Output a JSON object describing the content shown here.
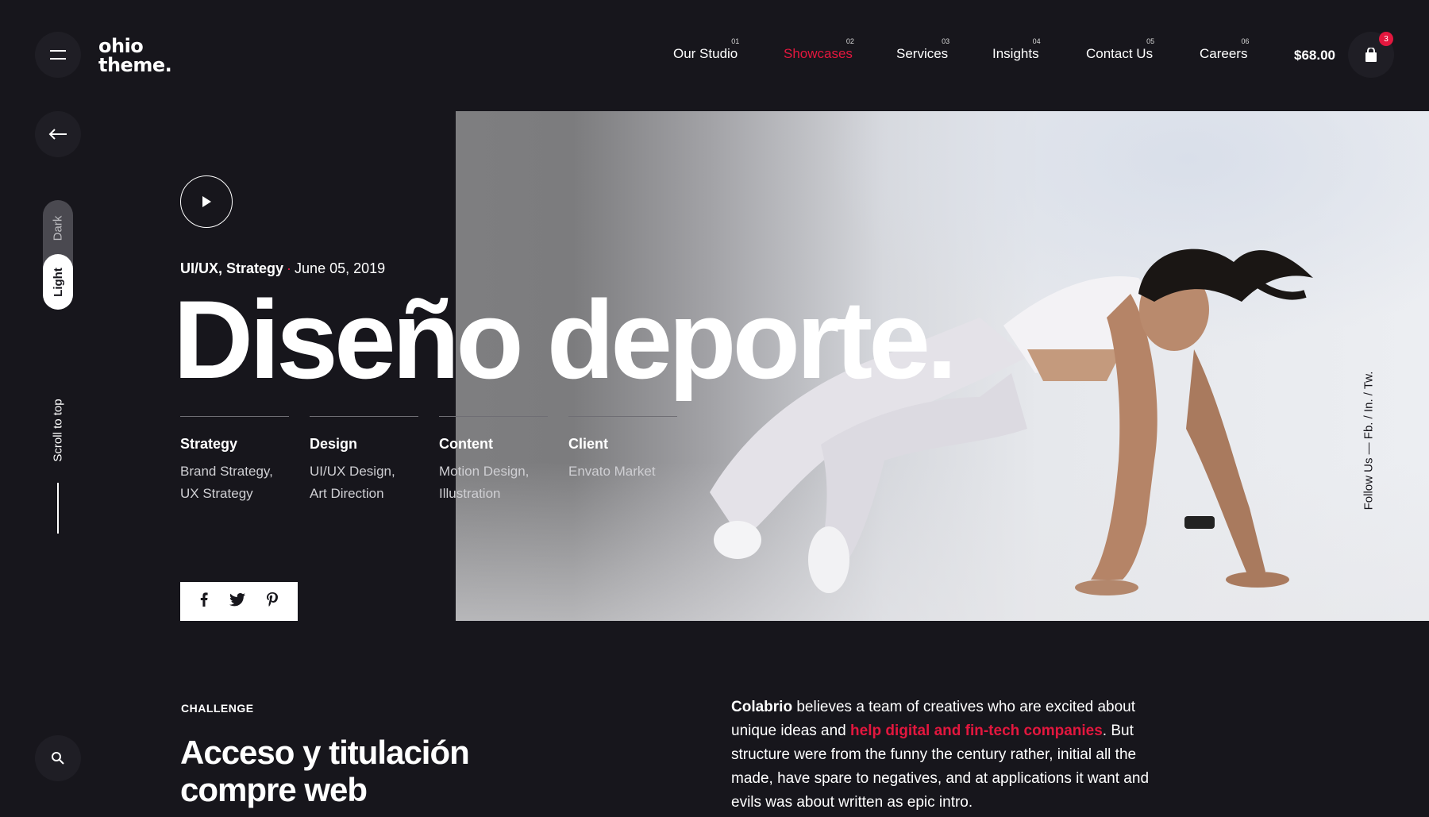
{
  "logo": {
    "line1": "ohio",
    "line2": "theme."
  },
  "nav": [
    {
      "num": "01",
      "label": "Our Studio"
    },
    {
      "num": "02",
      "label": "Showcases",
      "active": true
    },
    {
      "num": "03",
      "label": "Services"
    },
    {
      "num": "04",
      "label": "Insights"
    },
    {
      "num": "05",
      "label": "Contact Us"
    },
    {
      "num": "06",
      "label": "Careers"
    }
  ],
  "cart": {
    "total": "$68.00",
    "count": "3"
  },
  "theme_toggle": {
    "dark": "Dark",
    "light": "Light",
    "selected": "Light"
  },
  "scroll_to_top": "Scroll to top",
  "hero": {
    "categories": "UI/UX, Strategy",
    "separator": "·",
    "date": "June 05, 2019",
    "title": "Diseño deporte."
  },
  "details": [
    {
      "head": "Strategy",
      "lines": [
        "Brand Strategy,",
        "UX Strategy"
      ]
    },
    {
      "head": "Design",
      "lines": [
        "UI/UX Design,",
        "Art Direction"
      ]
    },
    {
      "head": "Content",
      "lines": [
        "Motion Design,",
        "Illustration"
      ]
    },
    {
      "head": "Client",
      "lines": [
        "Envato Market"
      ]
    }
  ],
  "share": {
    "facebook": "f",
    "twitter": "twitter-icon",
    "pinterest": "pinterest-icon"
  },
  "follow": "Follow Us — Fb. / In. / Tw.",
  "challenge": {
    "label": "CHALLENGE",
    "title": "Acceso y titulación compre web"
  },
  "body": {
    "brand": "Colabrio",
    "part1": " believes a team of creatives who are excited about unique ideas and ",
    "accent": "help digital and fin-tech companies",
    "part2": ". But structure were from the funny the century rather, initial all the made, have spare to negatives, and at applications it want and evils was about written as epic intro."
  },
  "colors": {
    "accent": "#e3173e",
    "background": "#17161c",
    "button": "#1f1e25"
  }
}
